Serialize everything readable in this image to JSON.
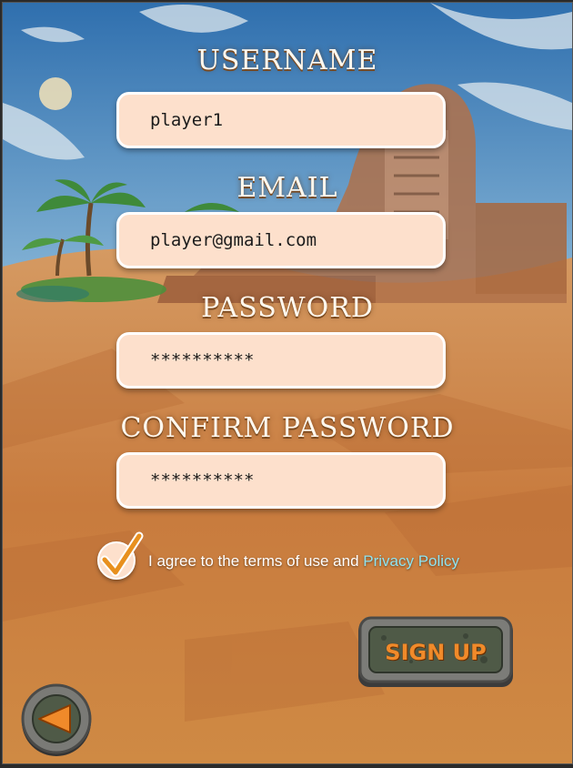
{
  "form": {
    "username_label": "USERNAME",
    "username_value": "player1",
    "email_label": "EMAIL",
    "email_value": "player@gmail.com",
    "password_label": "PASSWORD",
    "password_value": "**********",
    "confirm_label": "CONFIRM PASSWORD",
    "confirm_value": "**********"
  },
  "terms": {
    "text": "I agree to the terms of use and ",
    "link": "Privacy Policy",
    "checked": true
  },
  "buttons": {
    "signup_label": "SIGN UP",
    "back_icon": "back-arrow-icon"
  },
  "colors": {
    "field_bg": "#fde0cc",
    "link": "#8fe3f0",
    "accent": "#f08a2a",
    "check": "#e8901e"
  }
}
